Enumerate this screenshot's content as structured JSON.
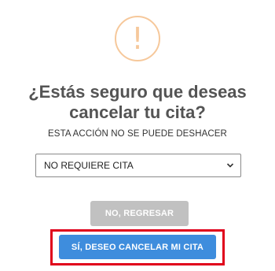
{
  "dialog": {
    "icon": "exclamation-icon",
    "icon_glyph": "!",
    "icon_color": "#f6c89b",
    "title_line1": "¿Estás seguro que deseas",
    "title_line2": "cancelar tu cita?",
    "subtitle": "ESTA ACCIÓN NO SE PUEDE DESHACER",
    "reason_select": {
      "selected": "NO REQUIERE CITA"
    },
    "back_button": "NO, REGRESAR",
    "confirm_button": "SÍ, DESEO CANCELAR MI CITA",
    "colors": {
      "confirm": "#3e8ddd",
      "back": "#c1c1c1",
      "highlight": "#e0001b"
    }
  }
}
